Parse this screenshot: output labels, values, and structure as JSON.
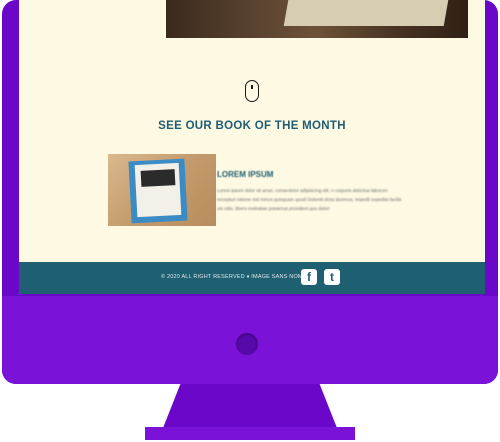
{
  "section": {
    "title": "SEE OUR BOOK OF THE MONTH"
  },
  "book": {
    "heading": "LOREM IPSUM",
    "text": "Lorem ipsum dolor sit amet, consectetur adipisicing elit. A corporis delectus laborum excepturi ratione nisi minus quisquam quod! Deleniti dicta ducimus, impedit expedita facilis uis odio, libero molestias possimus provident quo dolor!"
  },
  "footer": {
    "copyright": "© 2020 ALL RIGHT RESERVED ♦ IMAGE SANS NOM",
    "social": [
      {
        "icon": "facebook-icon",
        "glyph": "f"
      },
      {
        "icon": "twitter-icon",
        "glyph": "t"
      }
    ]
  },
  "colors": {
    "monitor": "#6a07c8",
    "screen_bg": "#fdf9e2",
    "accent": "#1f5d73",
    "footer": "#1f5f72"
  }
}
